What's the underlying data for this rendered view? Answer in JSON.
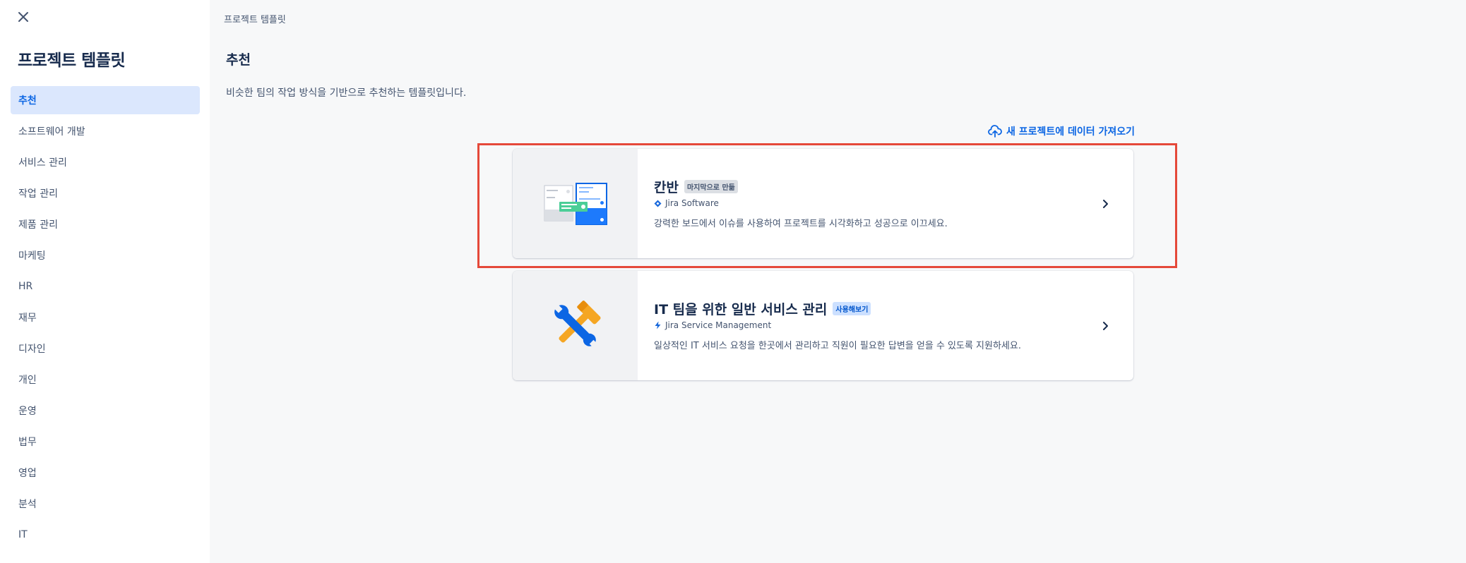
{
  "sidebar": {
    "title": "프로젝트 템플릿",
    "items": [
      {
        "label": "추천",
        "active": true
      },
      {
        "label": "소프트웨어 개발"
      },
      {
        "label": "서비스 관리"
      },
      {
        "label": "작업 관리"
      },
      {
        "label": "제품 관리"
      },
      {
        "label": "마케팅"
      },
      {
        "label": "HR"
      },
      {
        "label": "재무"
      },
      {
        "label": "디자인"
      },
      {
        "label": "개인"
      },
      {
        "label": "운영"
      },
      {
        "label": "법무"
      },
      {
        "label": "영업"
      },
      {
        "label": "분석"
      },
      {
        "label": "IT"
      }
    ]
  },
  "main": {
    "breadcrumb": "프로젝트 템플릿",
    "title": "추천",
    "description": "비슷한 팀의 작업 방식을 기반으로 추천하는 템플릿입니다.",
    "import_link": "새 프로젝트에 데이터 가져오기",
    "cards": [
      {
        "title": "칸반",
        "badge": "마지막으로 만듦",
        "product": "Jira Software",
        "description": "강력한 보드에서 이슈를 사용하여 프로젝트를 시각화하고 성공으로 이끄세요.",
        "selected": true
      },
      {
        "title": "IT 팀을 위한 일반 서비스 관리",
        "badge": "사용해보기",
        "product": "Jira Service Management",
        "description": "일상적인 IT 서비스 요청을 한곳에서 관리하고 직원이 필요한 답변을 얻을 수 있도록 지원하세요."
      }
    ]
  },
  "icons": {
    "close": "close-icon",
    "upload": "cloud-upload-icon",
    "jira_software": "jira-software-icon",
    "jira_service_management": "jira-service-management-icon",
    "chevron": "chevron-right-icon"
  },
  "colors": {
    "accent": "#0c66e4",
    "highlight": "#e5493a",
    "active_nav_bg": "#dbe7fd"
  }
}
